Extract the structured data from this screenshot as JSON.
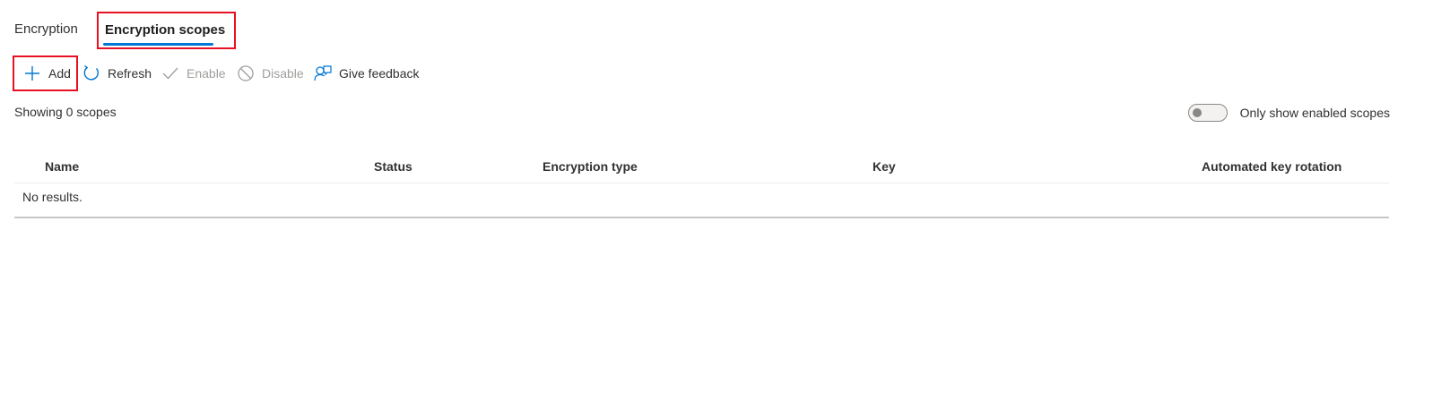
{
  "tabs": [
    {
      "label": "Encryption"
    },
    {
      "label": "Encryption scopes"
    }
  ],
  "toolbar": {
    "add_label": "Add",
    "refresh_label": "Refresh",
    "enable_label": "Enable",
    "disable_label": "Disable",
    "feedback_label": "Give feedback"
  },
  "summary": {
    "showing_text": "Showing 0 scopes"
  },
  "filter": {
    "toggle_label": "Only show enabled scopes",
    "enabled": false
  },
  "table": {
    "columns": [
      "Name",
      "Status",
      "Encryption type",
      "Key",
      "Automated key rotation"
    ],
    "empty_text": "No results."
  },
  "colors": {
    "accent": "#0078d4",
    "highlight_box": "#e81123",
    "disabled_text": "#a19f9d"
  },
  "icons": {
    "add": "plus-icon",
    "refresh": "refresh-icon",
    "enable": "checkmark-icon",
    "disable": "block-icon",
    "feedback": "feedback-icon"
  }
}
